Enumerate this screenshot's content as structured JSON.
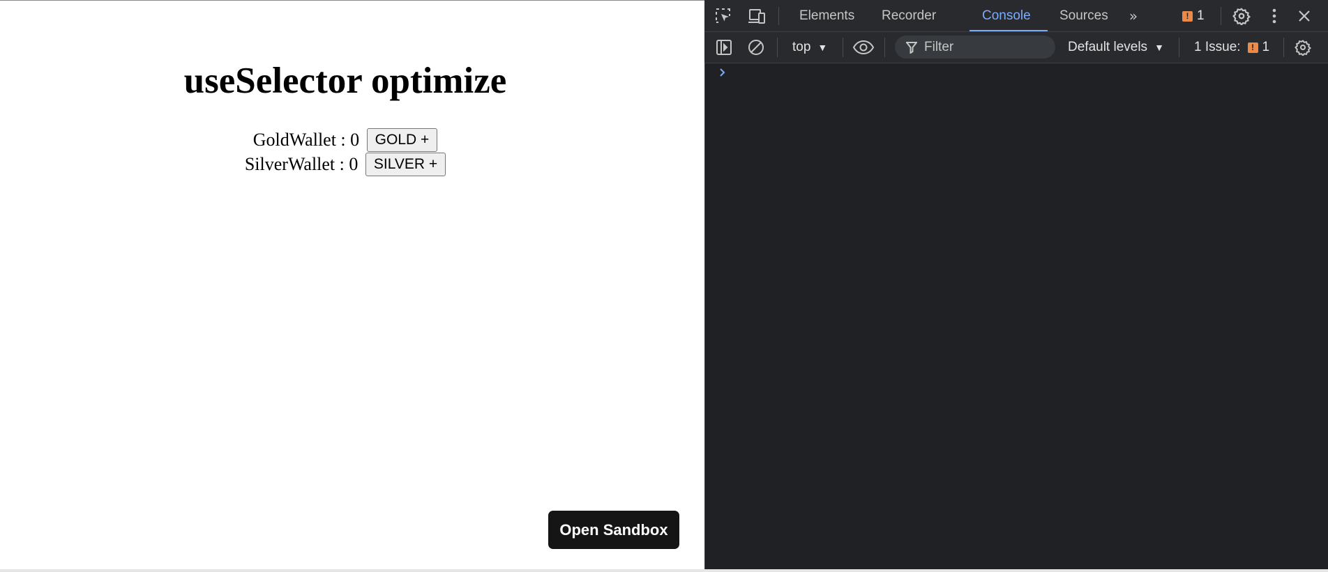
{
  "app": {
    "title": "useSelector optimize",
    "gold": {
      "label": "GoldWallet : ",
      "value": "0",
      "button": "GOLD +"
    },
    "silver": {
      "label": "SilverWallet : ",
      "value": "0",
      "button": "SILVER +"
    },
    "open_sandbox": "Open Sandbox"
  },
  "devtools": {
    "tabs": [
      "Elements",
      "Recorder",
      "Console",
      "Sources"
    ],
    "active_tab": "Console",
    "issues_count": "1",
    "toolbar": {
      "context": "top",
      "filter_placeholder": "Filter",
      "levels": "Default levels",
      "issues_label": "1 Issue:",
      "issues_count": "1"
    }
  },
  "colors": {
    "devtools_bg": "#202124",
    "devtools_bar": "#292a2d",
    "accent": "#7cacf8",
    "issue_badge": "#ee8a48",
    "sandbox_button": "#151515"
  }
}
